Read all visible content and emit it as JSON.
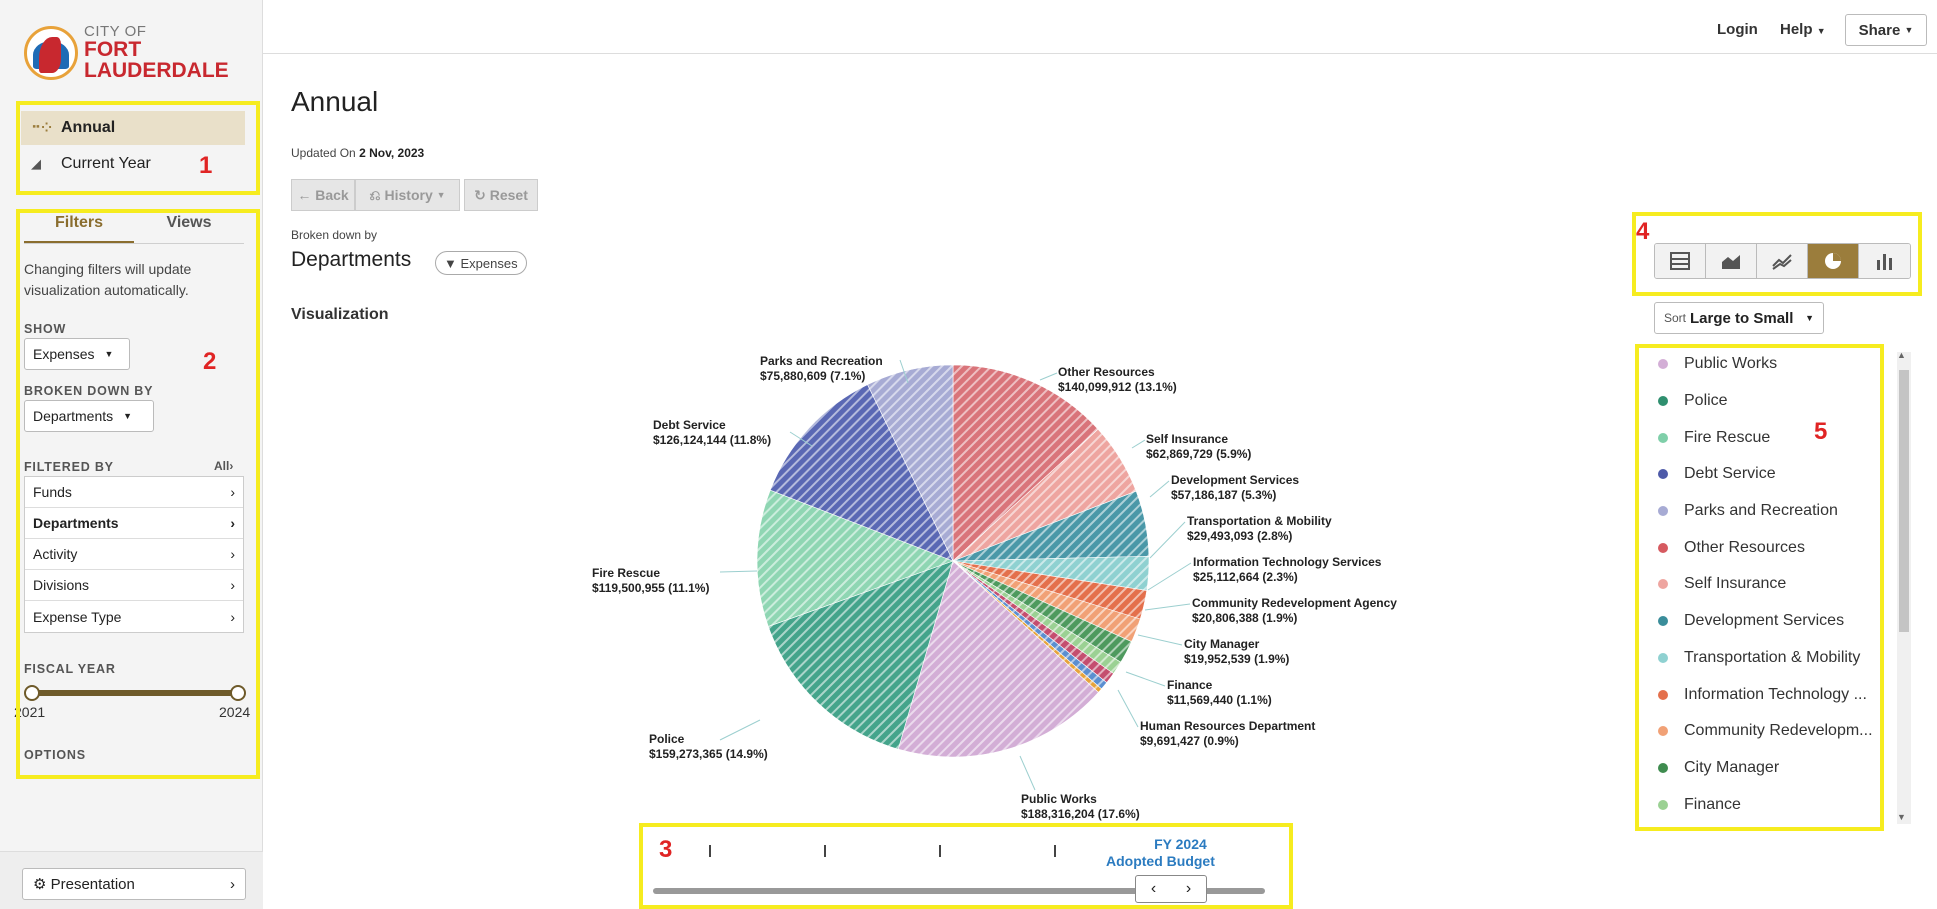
{
  "logo": {
    "line1": "CITY OF",
    "line2": "FORT",
    "line3": "LAUDERDALE"
  },
  "nav": [
    {
      "label": "Annual",
      "icon": "scatter-icon",
      "active": true
    },
    {
      "label": "Current Year",
      "icon": "area-chart-icon",
      "active": false
    }
  ],
  "annotations": [
    "1",
    "2",
    "3",
    "4",
    "5"
  ],
  "sidebar": {
    "tabs": [
      "Filters",
      "Views"
    ],
    "help_text": "Changing filters will update visualization automatically.",
    "show_label": "SHOW",
    "show_value": "Expenses",
    "broken_label": "BROKEN DOWN BY",
    "broken_value": "Departments",
    "filtered_label": "FILTERED BY",
    "filtered_all": "All",
    "filters": [
      {
        "label": "Funds",
        "bold": false
      },
      {
        "label": "Departments",
        "bold": true
      },
      {
        "label": "Activity",
        "bold": false
      },
      {
        "label": "Divisions",
        "bold": false
      },
      {
        "label": "Expense Type",
        "bold": false
      }
    ],
    "fiscal_label": "FISCAL YEAR",
    "fy_start": "2021",
    "fy_end": "2024",
    "options_label": "OPTIONS",
    "presentation": "Presentation"
  },
  "topbar": {
    "login": "Login",
    "help": "Help",
    "share": "Share"
  },
  "main": {
    "title": "Annual",
    "updated_prefix": "Updated On",
    "updated_date": "2 Nov, 2023",
    "back": "Back",
    "history": "History",
    "reset": "Reset",
    "broken_by": "Broken down by",
    "dimension": "Departments",
    "filter_pill": "Expenses",
    "viz_label": "Visualization"
  },
  "chart_data": {
    "type": "pie",
    "slices": [
      {
        "name": "Other Resources",
        "value": 140099912,
        "pct": "13.1%",
        "color": "#d9747a"
      },
      {
        "name": "Self Insurance",
        "value": 62869729,
        "pct": "5.9%",
        "color": "#eea5a0"
      },
      {
        "name": "Development Services",
        "value": 57186187,
        "pct": "5.3%",
        "color": "#4a98a8"
      },
      {
        "name": "Transportation & Mobility",
        "value": 29493093,
        "pct": "2.8%",
        "color": "#8fd1d1"
      },
      {
        "name": "Information Technology Services",
        "value": 25112664,
        "pct": "2.3%",
        "color": "#e4704c"
      },
      {
        "name": "Community Redevelopment Agency",
        "value": 20806388,
        "pct": "1.9%",
        "color": "#f1a176"
      },
      {
        "name": "City Manager",
        "value": 19952539,
        "pct": "1.9%",
        "color": "#4e9a5e"
      },
      {
        "name": "Finance",
        "value": 11569440,
        "pct": "1.1%",
        "color": "#9bd193"
      },
      {
        "name": "Human Resources Department",
        "value": 9691427,
        "pct": "0.9%",
        "color": "#c44e6f"
      },
      {
        "name": "",
        "value": 7000000,
        "pct": "",
        "color": "#5b8fd0"
      },
      {
        "name": "",
        "value": 4000000,
        "pct": "",
        "color": "#e7a33b"
      },
      {
        "name": "Public Works",
        "value": 188316204,
        "pct": "17.6%",
        "color": "#d3aed6"
      },
      {
        "name": "Police",
        "value": 159273365,
        "pct": "14.9%",
        "color": "#44a48b"
      },
      {
        "name": "Fire Rescue",
        "value": 119500955,
        "pct": "11.1%",
        "color": "#8fd6b3"
      },
      {
        "name": "Debt Service",
        "value": 126124144,
        "pct": "11.8%",
        "color": "#5a68b4"
      },
      {
        "name": "Parks and Recreation",
        "value": 75880609,
        "pct": "7.1%",
        "color": "#a7abd4"
      }
    ],
    "labels": [
      {
        "name": "Other Resources",
        "amount": "$140,099,912 (13.1%)"
      },
      {
        "name": "Self Insurance",
        "amount": "$62,869,729 (5.9%)"
      },
      {
        "name": "Development Services",
        "amount": "$57,186,187 (5.3%)"
      },
      {
        "name": "Transportation & Mobility",
        "amount": "$29,493,093 (2.8%)"
      },
      {
        "name": "Information Technology Services",
        "amount": "$25,112,664 (2.3%)"
      },
      {
        "name": "Community Redevelopment Agency",
        "amount": "$20,806,388 (1.9%)"
      },
      {
        "name": "City Manager",
        "amount": "$19,952,539 (1.9%)"
      },
      {
        "name": "Finance",
        "amount": "$11,569,440 (1.1%)"
      },
      {
        "name": "Human Resources Department",
        "amount": "$9,691,427 (0.9%)"
      },
      {
        "name": "Public Works",
        "amount": "$188,316,204 (17.6%)"
      },
      {
        "name": "Police",
        "amount": "$159,273,365 (14.9%)"
      },
      {
        "name": "Fire Rescue",
        "amount": "$119,500,955 (11.1%)"
      },
      {
        "name": "Debt Service",
        "amount": "$126,124,144 (11.8%)"
      },
      {
        "name": "Parks and Recreation",
        "amount": "$75,880,609 (7.1%)"
      }
    ]
  },
  "timeline": {
    "fy": "FY 2024",
    "budget": "Adopted Budget",
    "prev": "‹",
    "next": "›",
    "ticks": 4
  },
  "chart_types": [
    {
      "icon": "table-chart-icon",
      "active": false
    },
    {
      "icon": "area-chart-icon",
      "active": false
    },
    {
      "icon": "line-chart-icon",
      "active": false
    },
    {
      "icon": "pie-chart-icon",
      "active": true
    },
    {
      "icon": "bar-chart-icon",
      "active": false
    }
  ],
  "sort": {
    "prefix": "Sort",
    "value": "Large to Small"
  },
  "legend": [
    {
      "label": "Public Works",
      "color": "#d3aed6"
    },
    {
      "label": "Police",
      "color": "#2f8f6f"
    },
    {
      "label": "Fire Rescue",
      "color": "#7fcfa9"
    },
    {
      "label": "Debt Service",
      "color": "#4e5aa8"
    },
    {
      "label": "Parks and Recreation",
      "color": "#a7abd4"
    },
    {
      "label": "Other Resources",
      "color": "#d65a60"
    },
    {
      "label": "Self Insurance",
      "color": "#eea5a0"
    },
    {
      "label": "Development Services",
      "color": "#3a8d9a"
    },
    {
      "label": "Transportation & Mobility",
      "color": "#8fd1d1"
    },
    {
      "label": "Information Technology ...",
      "color": "#e4704c"
    },
    {
      "label": "Community Redevelopm...",
      "color": "#f1a176"
    },
    {
      "label": "City Manager",
      "color": "#3f8c4f"
    },
    {
      "label": "Finance",
      "color": "#9bd193"
    }
  ]
}
